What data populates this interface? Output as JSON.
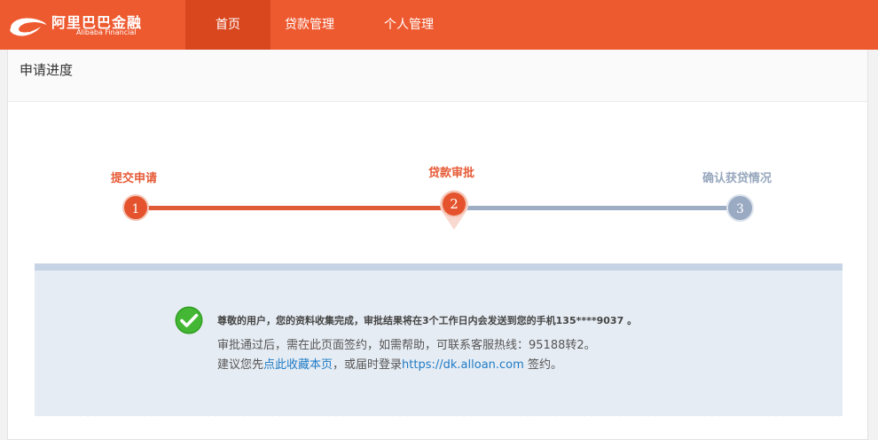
{
  "header": {
    "logo_cn": "阿里巴巴金融",
    "logo_en": "Alibaba Financial",
    "nav": [
      {
        "label": "首页",
        "active": true
      },
      {
        "label": "贷款管理",
        "active": false
      },
      {
        "label": "个人管理",
        "active": false
      }
    ]
  },
  "panel": {
    "title": "申请进度"
  },
  "steps": [
    {
      "num": "1",
      "label": "提交申请",
      "state": "done"
    },
    {
      "num": "2",
      "label": "贷款审批",
      "state": "current"
    },
    {
      "num": "3",
      "label": "确认获贷情况",
      "state": "todo"
    }
  ],
  "message": {
    "headline": "尊敬的用户，您的资料收集完成，审批结果将在3个工作日内会发送到您的手机135****9037 。",
    "line1": "审批通过后，需在此页面签约，如需帮助，可联系客服热线：95188转2。",
    "line2_prefix": "建议您先",
    "line2_link1": "点此收藏本页",
    "line2_mid": "，或届时登录",
    "line2_link2": "https://dk.alloan.com",
    "line2_suffix": " 签约。"
  },
  "icons": {
    "logo": "alibaba-smile-icon",
    "check": "check-circle-icon",
    "pin": "location-pin-icon"
  },
  "colors": {
    "brand": "#ee5a30",
    "nav_active": "#d9471f",
    "step_done": "#e15a38",
    "step_todo": "#9daec4",
    "success": "#3ab52b",
    "link": "#1e7bc6"
  }
}
